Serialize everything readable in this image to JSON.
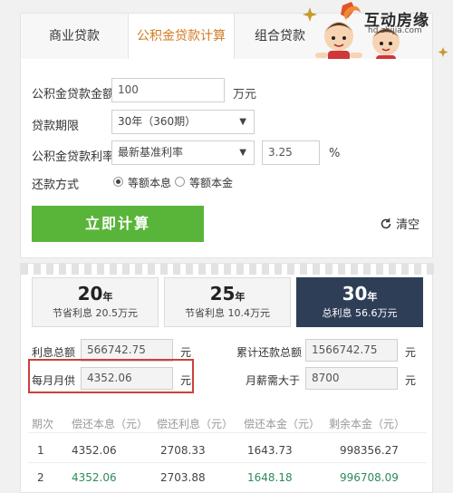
{
  "tabs": [
    "商业贷款",
    "公积金贷款计算",
    "组合贷款"
  ],
  "logo": {
    "brand": "互动房缘",
    "url": "hd.zhijia.com"
  },
  "form": {
    "amount_label": "公积金贷款金额",
    "amount_value": "100",
    "amount_unit": "万元",
    "term_label": "贷款期限",
    "term_value": "30年（360期）",
    "rate_label": "公积金贷款利率",
    "rate_select": "最新基准利率",
    "rate_value": "3.25",
    "rate_unit": "%",
    "method_label": "还款方式",
    "method_options": [
      "等额本息",
      "等额本金"
    ],
    "method_selected": "等额本息",
    "calc_button": "立即计算",
    "clear_button": "清空"
  },
  "year_options": [
    {
      "year": "20",
      "unit": "年",
      "note": "节省利息 20.5万元"
    },
    {
      "year": "25",
      "unit": "年",
      "note": "节省利息 10.4万元"
    },
    {
      "year": "30",
      "unit": "年",
      "note": "总利息 56.6万元"
    }
  ],
  "summary": {
    "total_interest_label": "利息总额",
    "total_interest": "566742.75",
    "total_repay_label": "累计还款总额",
    "total_repay": "1566742.75",
    "monthly_label": "每月月供",
    "monthly": "4352.06",
    "salary_label": "月薪需大于",
    "salary": "8700",
    "unit": "元"
  },
  "schedule": {
    "headers": [
      "期次",
      "偿还本息（元）",
      "偿还利息（元）",
      "偿还本金（元）",
      "剩余本金（元）"
    ],
    "rows": [
      [
        "1",
        "4352.06",
        "2708.33",
        "1643.73",
        "998356.27"
      ],
      [
        "2",
        "4352.06",
        "2703.88",
        "1648.18",
        "996708.09"
      ]
    ]
  },
  "colors": {
    "accent": "#d27b22",
    "button": "#59b539",
    "active_year": "#2f3e57",
    "highlight": "#c9423d"
  }
}
